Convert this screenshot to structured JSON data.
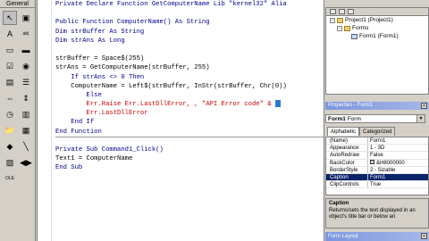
{
  "toolbox": {
    "title": "General",
    "tools": [
      {
        "name": "pointer-icon",
        "glyph": "↖"
      },
      {
        "name": "picturebox-icon",
        "glyph": "▣"
      },
      {
        "name": "label-icon",
        "glyph": "A"
      },
      {
        "name": "textbox-icon",
        "glyph": "ab|"
      },
      {
        "name": "frame-icon",
        "glyph": "▭"
      },
      {
        "name": "commandbutton-icon",
        "glyph": "▬"
      },
      {
        "name": "checkbox-icon",
        "glyph": "☑"
      },
      {
        "name": "optionbutton-icon",
        "glyph": "◉"
      },
      {
        "name": "combobox-icon",
        "glyph": "▤"
      },
      {
        "name": "listbox-icon",
        "glyph": "☰"
      },
      {
        "name": "hscroll-icon",
        "glyph": "⇔"
      },
      {
        "name": "vscroll-icon",
        "glyph": "⇕"
      },
      {
        "name": "timer-icon",
        "glyph": "◷"
      },
      {
        "name": "drivelist-icon",
        "glyph": "▥"
      },
      {
        "name": "dirlist-icon",
        "glyph": "📁"
      },
      {
        "name": "filelist-icon",
        "glyph": "▦"
      },
      {
        "name": "shape-icon",
        "glyph": "◆"
      },
      {
        "name": "line-icon",
        "glyph": "╲"
      },
      {
        "name": "image-icon",
        "glyph": "▨"
      },
      {
        "name": "data-icon",
        "glyph": "◀▶"
      },
      {
        "name": "ole-icon",
        "glyph": "OLE"
      }
    ]
  },
  "code": {
    "lines": [
      {
        "text": "Private Declare Function GetComputerName Lib \"kernel32\" Alia",
        "cls": "kw"
      },
      {
        "text": "",
        "cls": ""
      },
      {
        "text": "Public Function ComputerName() As String",
        "cls": "kw"
      },
      {
        "text": "Dim strBuffer As String",
        "cls": "kw"
      },
      {
        "text": "Dim strAns As Long",
        "cls": "kw"
      },
      {
        "text": "",
        "cls": ""
      },
      {
        "text": "strBuffer = Space$(255)",
        "cls": ""
      },
      {
        "text": "strAns = GetComputerName(strBuffer, 255)",
        "cls": ""
      },
      {
        "text": "    If strAns <> 0 Then",
        "cls": "kw"
      },
      {
        "text": "    ComputerName = Left$(strBuffer, InStr(strBuffer, Chr(0))",
        "cls": ""
      },
      {
        "text": "        Else",
        "cls": "kw"
      },
      {
        "text": "        Err.Raise Err.LastDllError, , \"API Error code\" &",
        "cls": "err"
      },
      {
        "text": "        Err.LastDllError",
        "cls": "err"
      },
      {
        "text": "    End If",
        "cls": "kw"
      },
      {
        "text": "End Function",
        "cls": "kw"
      },
      {
        "text": "",
        "cls": "sep"
      },
      {
        "text": "Private Sub Command1_Click()",
        "cls": "kw"
      },
      {
        "text": "Text1 = ComputerName",
        "cls": ""
      },
      {
        "text": "End Sub",
        "cls": "kw"
      }
    ]
  },
  "project": {
    "root": "Project1 (Project1)",
    "folder": "Forms",
    "item": "Form1 (Form1)"
  },
  "properties": {
    "title": "Properties - Form1",
    "object_name": "Form1",
    "object_type": "Form",
    "tabs": [
      "Alphabetic",
      "Categorized"
    ],
    "rows": [
      {
        "name": "(Name)",
        "value": "Form1"
      },
      {
        "name": "Appearance",
        "value": "1 - 3D"
      },
      {
        "name": "AutoRedraw",
        "value": "False"
      },
      {
        "name": "BackColor",
        "value": "&H8000000"
      },
      {
        "name": "BorderStyle",
        "value": "2 - Sizable"
      },
      {
        "name": "Caption",
        "value": "Form1"
      },
      {
        "name": "ClipControls",
        "value": "True"
      }
    ],
    "selected_row": 5,
    "desc_title": "Caption",
    "desc_text": "Returns/sets the text displayed in an object's title bar or below an"
  },
  "form_layout": {
    "title": "Form Layout"
  }
}
